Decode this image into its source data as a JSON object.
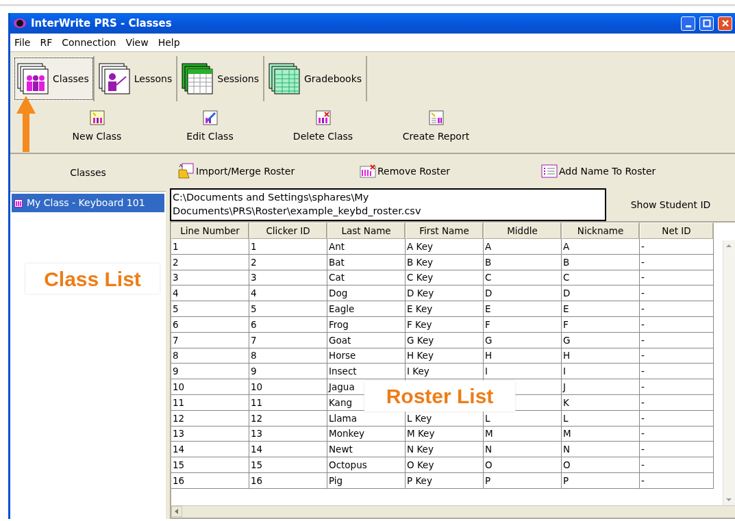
{
  "window": {
    "title": "InterWrite PRS - Classes"
  },
  "menu": [
    "File",
    "RF",
    "Connection",
    "View",
    "Help"
  ],
  "tabs": [
    {
      "label": "Classes",
      "selected": true
    },
    {
      "label": "Lessons",
      "selected": false
    },
    {
      "label": "Sessions",
      "selected": false
    },
    {
      "label": "Gradebooks",
      "selected": false
    }
  ],
  "actions": [
    "New Class",
    "Edit Class",
    "Delete Class",
    "Create Report"
  ],
  "classes_panel": {
    "header": "Classes",
    "items": [
      {
        "label": "My Class - Keyboard 101",
        "selected": true
      }
    ]
  },
  "roster_toolbar": [
    "Import/Merge Roster",
    "Remove Roster",
    "Add Name To Roster"
  ],
  "roster_path": "C:\\Documents and Settings\\sphares\\My Documents\\PRS\\Roster\\example_keybd_roster.csv",
  "show_student_id_button": "Show Student ID",
  "table": {
    "columns": [
      "Line Number",
      "Clicker ID",
      "Last Name",
      "First Name",
      "Middle",
      "Nickname",
      "Net ID"
    ],
    "rows": [
      [
        "1",
        "1",
        "Ant",
        "A Key",
        "A",
        "A",
        "-"
      ],
      [
        "2",
        "2",
        "Bat",
        "B Key",
        "B",
        "B",
        "-"
      ],
      [
        "3",
        "3",
        "Cat",
        "C Key",
        "C",
        "C",
        "-"
      ],
      [
        "4",
        "4",
        "Dog",
        "D Key",
        "D",
        "D",
        "-"
      ],
      [
        "5",
        "5",
        "Eagle",
        "E Key",
        "E",
        "E",
        "-"
      ],
      [
        "6",
        "6",
        "Frog",
        "F Key",
        "F",
        "F",
        "-"
      ],
      [
        "7",
        "7",
        "Goat",
        "G Key",
        "G",
        "G",
        "-"
      ],
      [
        "8",
        "8",
        "Horse",
        "H Key",
        "H",
        "H",
        "-"
      ],
      [
        "9",
        "9",
        "Insect",
        "I Key",
        "I",
        "I",
        "-"
      ],
      [
        "10",
        "10",
        "Jagua",
        null,
        null,
        "J",
        "-"
      ],
      [
        "11",
        "11",
        "Kang",
        null,
        null,
        "K",
        "-"
      ],
      [
        "12",
        "12",
        "Llama",
        "L Key",
        "L",
        "L",
        "-"
      ],
      [
        "13",
        "13",
        "Monkey",
        "M Key",
        "M",
        "M",
        "-"
      ],
      [
        "14",
        "14",
        "Newt",
        "N Key",
        "N",
        "N",
        "-"
      ],
      [
        "15",
        "15",
        "Octopus",
        "O Key",
        "O",
        "O",
        "-"
      ],
      [
        "16",
        "16",
        "Pig",
        "P Key",
        "P",
        "P",
        "-"
      ]
    ]
  },
  "annotations": [
    {
      "kind": "label",
      "text": "Class List"
    },
    {
      "kind": "label",
      "text": "Roster List"
    },
    {
      "kind": "arrow"
    }
  ]
}
